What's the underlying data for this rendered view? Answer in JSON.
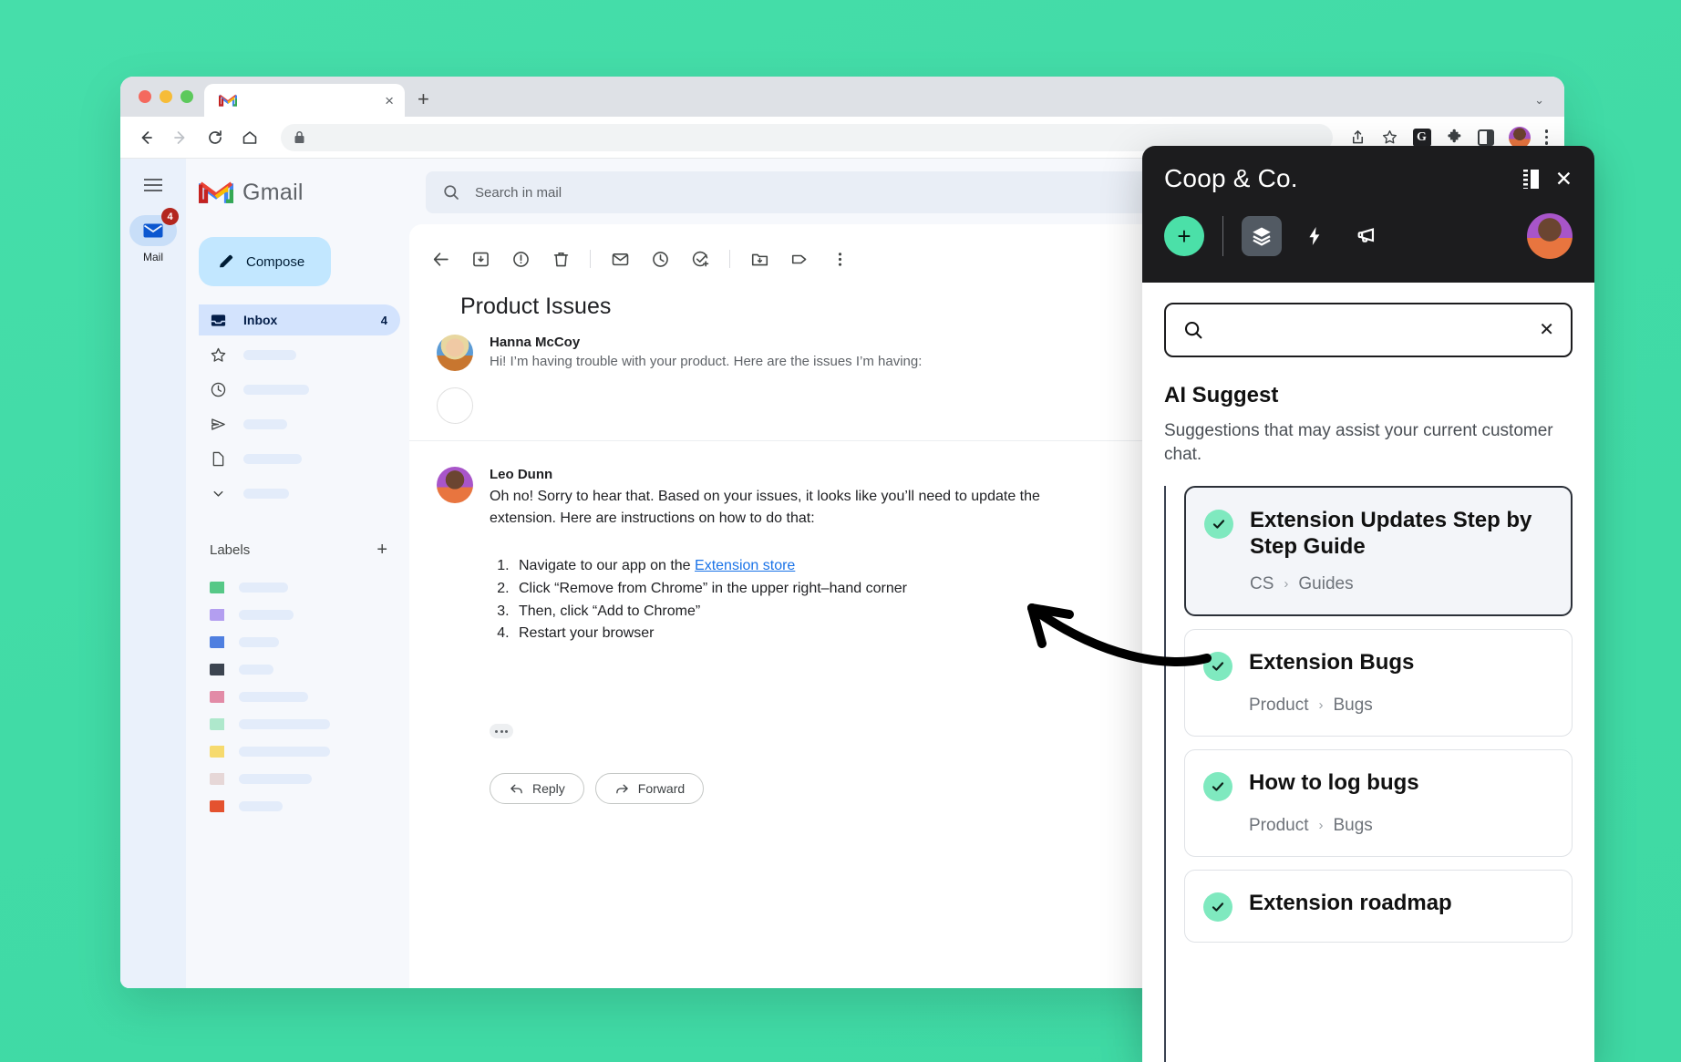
{
  "browser": {
    "tab_title": "",
    "tab_favicon": "gmail-icon",
    "new_tab_label": "+",
    "close_tab_label": "×",
    "tabstrip_chevron": "⌄",
    "url_value": "",
    "toolbar_icons": [
      "share-icon",
      "bookmark-star-icon",
      "grammarly-badge-icon",
      "extensions-puzzle-icon",
      "side-panel-icon",
      "profile-avatar",
      "chrome-menu-kebab"
    ],
    "grammarly_letter": "G"
  },
  "gmail": {
    "rail": {
      "mail_label": "Mail",
      "mail_badge": "4"
    },
    "brand": "Gmail",
    "compose_label": "Compose",
    "nav": [
      {
        "label": "Inbox",
        "count": "4",
        "icon": "inbox-icon",
        "active": true
      },
      {
        "label": "",
        "count": "",
        "icon": "star-icon",
        "active": false
      },
      {
        "label": "",
        "count": "",
        "icon": "clock-snoozed-icon",
        "active": false
      },
      {
        "label": "",
        "count": "",
        "icon": "send-icon",
        "active": false
      },
      {
        "label": "",
        "count": "",
        "icon": "draft-file-icon",
        "active": false
      },
      {
        "label": "",
        "count": "",
        "icon": "chevron-down-icon",
        "active": false
      }
    ],
    "labels_header": "Labels",
    "labels_add": "+",
    "label_colors": [
      "#56c887",
      "#b39ef0",
      "#4f7fe0",
      "#3c4450",
      "#e28ba7",
      "#aee8cc",
      "#f6da6e",
      "#e6d7d7",
      "#e4522f"
    ],
    "search": {
      "placeholder": "Search in mail",
      "value": "",
      "icon": "search-icon",
      "filter_icon": "tune-icon"
    },
    "toolbar": [
      "back-arrow-icon",
      "archive-icon",
      "report-spam-icon",
      "delete-icon",
      "mark-unread-icon",
      "snooze-icon",
      "add-to-tasks-icon",
      "move-to-icon",
      "label-icon",
      "more-options-kebab"
    ],
    "thread": {
      "subject": "Product Issues",
      "messages": [
        {
          "sender": "Hanna McCoy",
          "preview": "Hi! I’m having trouble with your product. Here are the issues I’m having:"
        },
        {
          "sender": "Leo Dunn",
          "body": "Oh no! Sorry to hear that. Based on your issues, it looks like you’ll need to update the extension. Here are instructions on how to do that:",
          "steps": [
            {
              "pre": "Navigate to our app on the ",
              "link": "Extension store",
              "post": ""
            },
            {
              "pre": "Click “Remove from Chrome” in the upper right–hand corner",
              "link": "",
              "post": ""
            },
            {
              "pre": "Then, click “Add to Chrome”",
              "link": "",
              "post": ""
            },
            {
              "pre": "Restart your browser",
              "link": "",
              "post": ""
            }
          ]
        }
      ],
      "reply_label": "Reply",
      "forward_label": "Forward"
    }
  },
  "widget": {
    "title": "Coop & Co.",
    "layout_icon": "panel-layout-icon",
    "close_label": "✕",
    "add_label": "+",
    "tools": [
      {
        "icon": "layers-icon",
        "active": true
      },
      {
        "icon": "lightning-bolt-icon",
        "active": false
      },
      {
        "icon": "megaphone-icon",
        "active": false
      }
    ],
    "avatar": "user-avatar",
    "search": {
      "value": "",
      "placeholder": "",
      "icon": "search-icon",
      "clear_label": "✕"
    },
    "ai_title": "AI Suggest",
    "ai_subtitle": "Suggestions that may assist your current customer chat.",
    "cards": [
      {
        "title": "Extension Updates Step by Step Guide",
        "crumb_root": "CS",
        "crumb_sep": "›",
        "crumb_leaf": "Guides",
        "selected": true
      },
      {
        "title": "Extension Bugs",
        "crumb_root": "Product",
        "crumb_sep": "›",
        "crumb_leaf": "Bugs",
        "selected": false
      },
      {
        "title": "How to log bugs",
        "crumb_root": "Product",
        "crumb_sep": "›",
        "crumb_leaf": "Bugs",
        "selected": false
      },
      {
        "title": "Extension roadmap",
        "crumb_root": "",
        "crumb_sep": "",
        "crumb_leaf": "",
        "selected": false
      }
    ]
  },
  "annotation": {
    "arrow": "curved-arrow-pointing-left"
  },
  "colors": {
    "background": "#43dca6",
    "accent_green": "#4be0a8",
    "check_green": "#7fe9bf",
    "panel_dark": "#1c1c1e",
    "link_blue": "#1a73e8"
  }
}
